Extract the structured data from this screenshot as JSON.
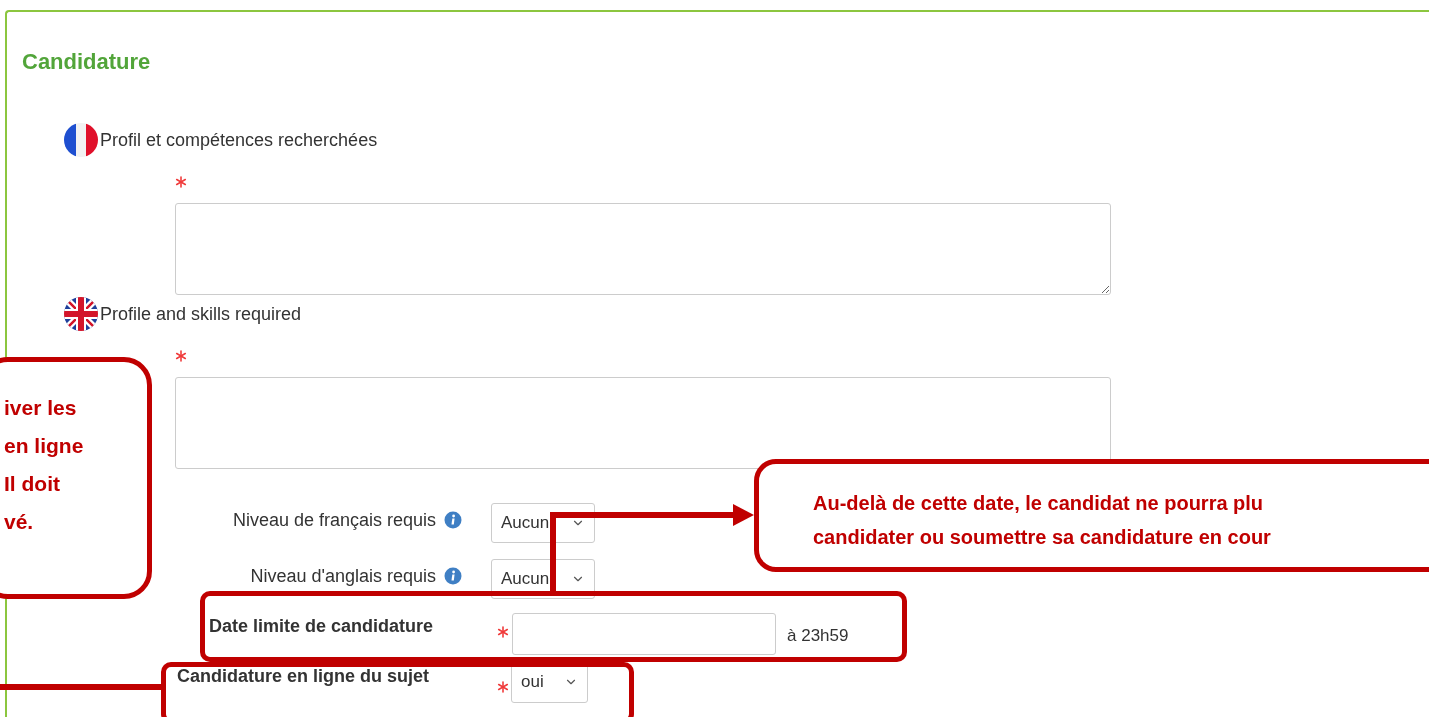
{
  "panel": {
    "title": "Candidature"
  },
  "text_fields": [
    {
      "kind": "fr",
      "label": "Profil et compétences recherchées",
      "required": true
    },
    {
      "kind": "uk",
      "label": "Profile and skills required",
      "required": true
    }
  ],
  "level_fields": [
    {
      "label": "Niveau de français requis",
      "info": true,
      "value": "Aucun"
    },
    {
      "label": "Niveau d'anglais requis",
      "info": true,
      "value": "Aucun"
    }
  ],
  "deadline": {
    "label": "Date limite de candidature",
    "required": true,
    "suffix": "à 23h59"
  },
  "online": {
    "label": "Candidature en ligne du sujet",
    "required": true,
    "value": "oui"
  },
  "annotations": {
    "left_callout": {
      "lines": [
        "iver les",
        "en ligne",
        "Il doit",
        "vé."
      ]
    },
    "right_callout": {
      "lines": [
        "Au-delà de cette date, le candidat ne pourra plu",
        "candidater ou soumettre sa candidature en cour"
      ]
    }
  }
}
